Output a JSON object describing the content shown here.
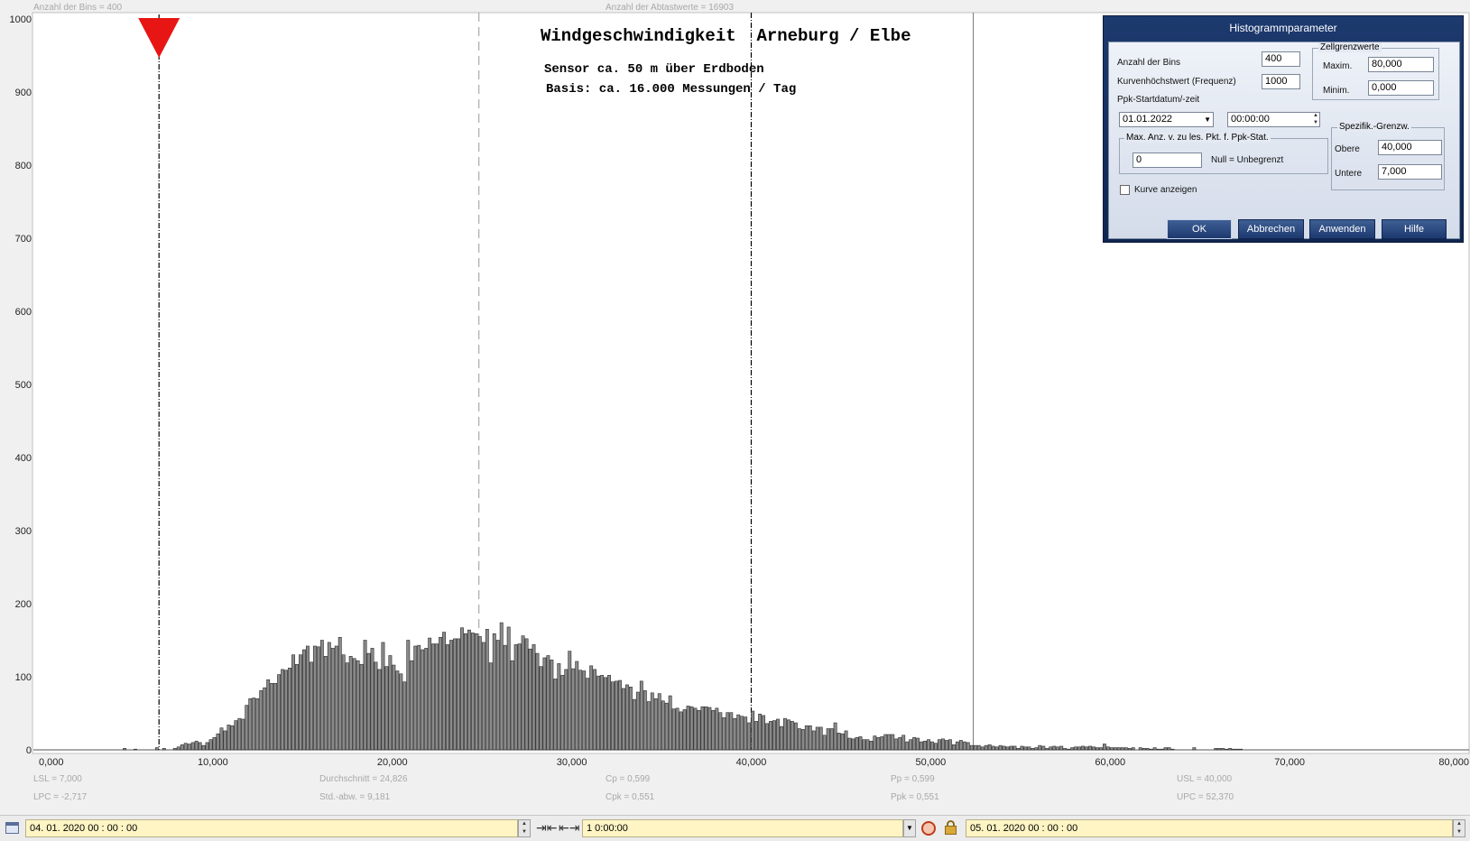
{
  "header": {
    "bins_info": "Anzahl der Bins =   400",
    "samples_info": "Anzahl der Abtastwerte = 16903"
  },
  "chart_data": {
    "type": "bar",
    "title": "Windgeschwindigkeit  Arneburg / Elbe",
    "subtitle1": "Sensor ca. 50 m über Erdboden",
    "subtitle2": "Basis: ca. 16.000 Messungen / Tag",
    "xlim": [
      0,
      80
    ],
    "ylim": [
      0,
      1000
    ],
    "x_tick_labels": [
      "0,000",
      "10,000",
      "20,000",
      "30,000",
      "40,000",
      "50,000",
      "60,000",
      "70,000",
      "80,000"
    ],
    "y_tick_labels": [
      "0",
      "100",
      "200",
      "300",
      "400",
      "500",
      "600",
      "700",
      "800",
      "900",
      "1000"
    ],
    "bin_width": 0.2,
    "bin_start": 5.0,
    "bin_counts": [
      2,
      0,
      0,
      1,
      0,
      0,
      0,
      0,
      0,
      3,
      0,
      2,
      0,
      0,
      2,
      4,
      7,
      9,
      8,
      10,
      12,
      10,
      6,
      10,
      14,
      17,
      22,
      30,
      26,
      34,
      33,
      40,
      43,
      42,
      61,
      70,
      71,
      70,
      81,
      85,
      96,
      91,
      91,
      103,
      110,
      109,
      112,
      130,
      117,
      130,
      137,
      142,
      120,
      142,
      141,
      150,
      128,
      147,
      139,
      142,
      154,
      130,
      119,
      128,
      125,
      122,
      117,
      150,
      132,
      139,
      120,
      110,
      147,
      114,
      129,
      116,
      108,
      104,
      93,
      150,
      122,
      142,
      143,
      137,
      139,
      153,
      145,
      145,
      154,
      161,
      144,
      150,
      152,
      152,
      167,
      159,
      164,
      160,
      159,
      155,
      147,
      165,
      119,
      159,
      150,
      174,
      143,
      168,
      122,
      144,
      145,
      156,
      152,
      138,
      144,
      132,
      114,
      126,
      129,
      123,
      97,
      118,
      102,
      110,
      135,
      111,
      121,
      109,
      108,
      98,
      115,
      110,
      101,
      102,
      99,
      102,
      93,
      94,
      95,
      84,
      89,
      86,
      69,
      79,
      94,
      81,
      66,
      78,
      70,
      77,
      67,
      64,
      74,
      56,
      57,
      52,
      55,
      60,
      59,
      57,
      54,
      59,
      59,
      58,
      54,
      57,
      51,
      44,
      51,
      51,
      43,
      48,
      46,
      45,
      37,
      53,
      39,
      49,
      47,
      36,
      39,
      40,
      42,
      32,
      43,
      41,
      39,
      37,
      29,
      28,
      33,
      33,
      26,
      31,
      31,
      20,
      29,
      29,
      37,
      23,
      22,
      26,
      16,
      15,
      17,
      18,
      14,
      14,
      12,
      19,
      17,
      18,
      21,
      21,
      21,
      15,
      17,
      20,
      11,
      14,
      17,
      16,
      11,
      12,
      14,
      11,
      9,
      14,
      15,
      13,
      14,
      7,
      11,
      13,
      11,
      10,
      6,
      6,
      6,
      4,
      6,
      7,
      5,
      4,
      6,
      5,
      4,
      5,
      5,
      2,
      5,
      4,
      4,
      2,
      3,
      6,
      5,
      2,
      4,
      5,
      4,
      5,
      2,
      1,
      3,
      4,
      4,
      5,
      4,
      5,
      4,
      3,
      3,
      8,
      4,
      3,
      3,
      3,
      3,
      3,
      2,
      3,
      0,
      3,
      2,
      2,
      1,
      3,
      1,
      1,
      3,
      3,
      1,
      0,
      0,
      0,
      0,
      0,
      3,
      0,
      0,
      0,
      0,
      0,
      2,
      2,
      2,
      1,
      2,
      1,
      1,
      1,
      0,
      0,
      0,
      0,
      0,
      0,
      0,
      0,
      0,
      0,
      0,
      0,
      0,
      0,
      0,
      0,
      0,
      0,
      0,
      0,
      0,
      0,
      0,
      0,
      0,
      0,
      0,
      0,
      0,
      0,
      0,
      0,
      0,
      0,
      0,
      0,
      0,
      0,
      0,
      0,
      0,
      0,
      0,
      0,
      0,
      0,
      0,
      0,
      0,
      0,
      0,
      0,
      0,
      0,
      0,
      0,
      0,
      0,
      0,
      0,
      0,
      0,
      0,
      0,
      0,
      0,
      0,
      0,
      0
    ],
    "markers": {
      "lsl": 7.0,
      "mean": 24.826,
      "usl": 40.0,
      "upc": 52.37
    },
    "bar_color": "#8a8a8a",
    "marker_color": "#e81515"
  },
  "stats": [
    {
      "label": "LSL = 7,000"
    },
    {
      "label": "LPC = -2,717"
    },
    {
      "label": "Durchschnitt  = 24,826"
    },
    {
      "label": "Std.-abw. = 9,181"
    },
    {
      "label": "Cp   = 0,599"
    },
    {
      "label": "Cpk = 0,551"
    },
    {
      "label": "Pp   = 0,599"
    },
    {
      "label": "Ppk = 0,551"
    },
    {
      "label": "USL = 40,000"
    },
    {
      "label": "UPC = 52,370"
    }
  ],
  "dialog": {
    "title": "Histogrammparameter",
    "bins_label": "Anzahl der Bins",
    "bins_value": "400",
    "curve_max_label": "Kurvenhöchstwert (Frequenz)",
    "curve_max_value": "1000",
    "ppk_start_label": "Ppk-Startdatum/-zeit",
    "ppk_date": "01.01.2022",
    "ppk_time": "00:00:00",
    "cell_limits_group": "Zellgrenzwerte",
    "max_label": "Maxim.",
    "max_value": "80,000",
    "min_label": "Minim.",
    "min_value": "0,000",
    "max_points_group": "Max. Anz. v. zu les. Pkt. f. Ppk-Stat.",
    "max_points_value": "0",
    "null_hint": "Null = Unbegrenzt",
    "spec_group": "Spezifik.-Grenzw.",
    "upper_label": "Obere",
    "upper_value": "40,000",
    "lower_label": "Untere",
    "lower_value": "7,000",
    "show_curve_label": "Kurve anzeigen",
    "ok_label": "OK",
    "cancel_label": "Abbrechen",
    "apply_label": "Anwenden",
    "help_label": "Hilfe"
  },
  "toolbar": {
    "start_datetime": "04. 01. 2020    00 : 00 : 00",
    "duration": "1  0:00:00",
    "end_datetime": "05. 01. 2020    00 : 00 : 00"
  }
}
